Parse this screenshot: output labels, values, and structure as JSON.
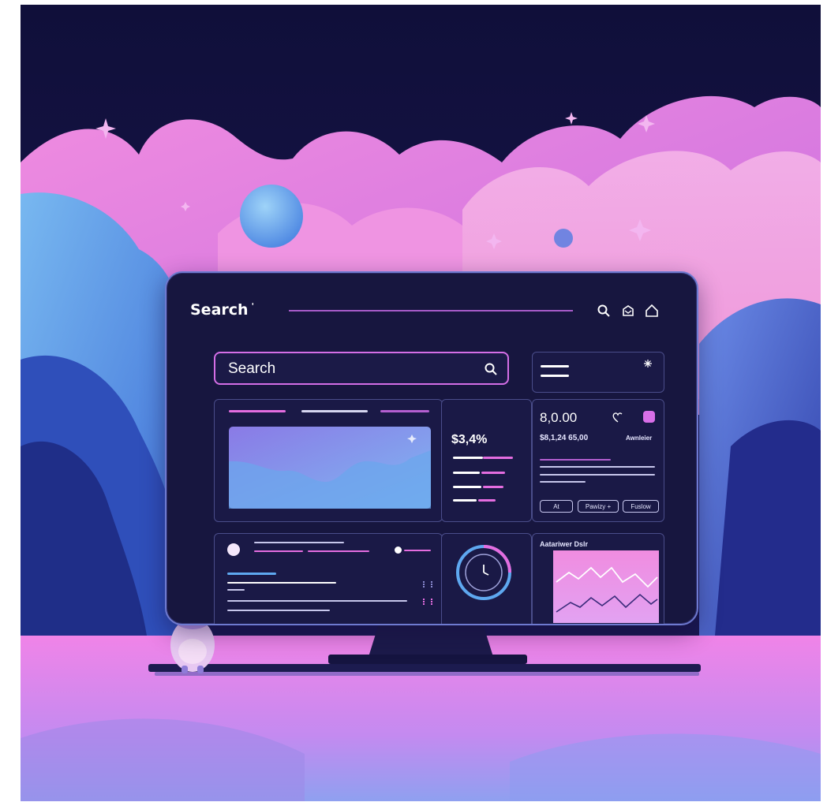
{
  "monitor": {
    "title": "Search",
    "title_mark": "'",
    "search": {
      "value": "Search"
    },
    "stats": {
      "value_a": "$3,4%",
      "value_b": "8,0.00",
      "value_c": "$8,1,24 65,00",
      "value_c_suffix": "Awnleier"
    },
    "buttons": [
      "At",
      "Pawizy +",
      "Fuslow"
    ],
    "chart_caption": "Aatariwer Dslr"
  },
  "icons": [
    "search-icon",
    "mail-icon",
    "home-icon",
    "clock-icon",
    "settings-icon",
    "heart-icon"
  ],
  "colors": {
    "night_sky": "#151447",
    "cloud_pink": "#e97ad6",
    "cloud_blue": "#5a88e6",
    "monitor_bg": "#17163f",
    "accent_pink": "#e46de0",
    "accent_blue": "#5ea8f0"
  }
}
